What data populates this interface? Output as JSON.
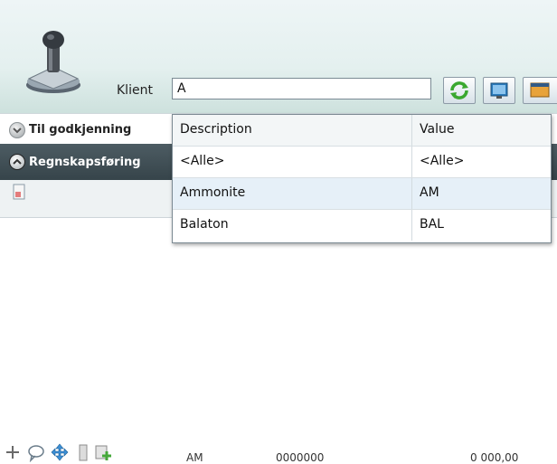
{
  "header": {
    "klient_label": "Klient",
    "klient_value": "A",
    "buttons": [
      {
        "name": "refresh-icon"
      },
      {
        "name": "monitor-icon"
      },
      {
        "name": "window-icon"
      }
    ]
  },
  "sections": [
    {
      "title": "Til godkjenning",
      "state": "collapsed"
    },
    {
      "title": "Regnskapsføring",
      "state": "expanded"
    }
  ],
  "grid_row": {
    "partial_code": "AM",
    "partial_number": "0000000",
    "partial_amount": "0 000,00"
  },
  "dropdown": {
    "columns": [
      "Description",
      "Value"
    ],
    "rows": [
      {
        "description": "<Alle>",
        "value": "<Alle>"
      },
      {
        "description": "Ammonite",
        "value": "AM"
      },
      {
        "description": "Balaton",
        "value": "BAL"
      }
    ],
    "highlighted_index": 1
  },
  "colors": {
    "header_gradient_bottom": "#cde1dd",
    "section_dark": "#3f4d54",
    "refresh_green": "#3aa82f",
    "selection": "#e6f0f8"
  }
}
